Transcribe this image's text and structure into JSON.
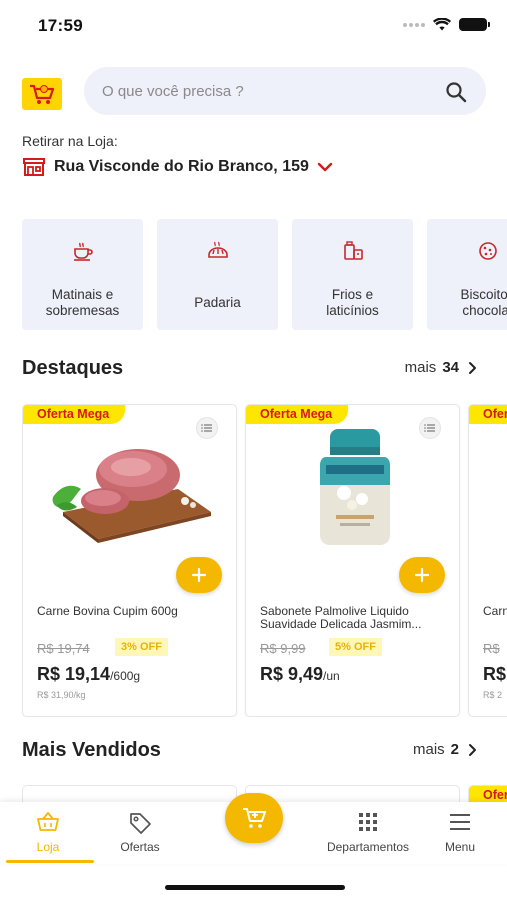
{
  "status_bar": {
    "time": "17:59"
  },
  "search": {
    "placeholder": "O que você precisa ?"
  },
  "pickup": {
    "label": "Retirar na Loja:",
    "store": "Rua Visconde do Rio Branco, 159"
  },
  "categories": [
    {
      "label": "Matinais e\nsobremesas",
      "icon": "coffee-cup-icon"
    },
    {
      "label": "Padaria",
      "icon": "bread-icon"
    },
    {
      "label": "Frios e\nlaticínios",
      "icon": "cheese-icon"
    },
    {
      "label": "Biscoitos\nchocolat",
      "icon": "cookie-icon"
    }
  ],
  "highlights": {
    "title": "Destaques",
    "more_label": "mais",
    "more_count": "34",
    "products": [
      {
        "badge": "Oferta Mega",
        "name": "Carne Bovina Cupim 600g",
        "old_price": "R$ 19,74",
        "discount": "3% OFF",
        "price": "R$ 19,14",
        "price_unit": "/600g",
        "unit_price": "R$ 31,90/kg",
        "image": "beef-image"
      },
      {
        "badge": "Oferta Mega",
        "name": "Sabonete Palmolive Liquido\nSuavidade Delicada Jasmim...",
        "old_price": "R$ 9,99",
        "discount": "5% OFF",
        "price": "R$ 9,49",
        "price_unit": "/un",
        "unit_price": "",
        "image": "soap-bottle-image"
      },
      {
        "badge": "Ofer",
        "name": "Carn",
        "old_price": "R$",
        "discount": "",
        "price": "R$",
        "price_unit": "",
        "unit_price": "R$ 2",
        "image": ""
      }
    ]
  },
  "best_sellers": {
    "title": "Mais Vendidos",
    "more_label": "mais",
    "more_count": "2",
    "peek_badge": "Ofer"
  },
  "bottom_nav": [
    {
      "label": "Loja",
      "icon": "basket-icon",
      "active": true
    },
    {
      "label": "Ofertas",
      "icon": "tag-icon",
      "active": false
    },
    {
      "label": "Departamentos",
      "icon": "grid-icon",
      "active": false
    },
    {
      "label": "Menu",
      "icon": "hamburger-icon",
      "active": false
    }
  ],
  "colors": {
    "accent": "#f5b800",
    "badge_yellow": "#ffe600",
    "badge_text": "#d41a1a",
    "card_bg": "#eef0fa",
    "store_icon": "#d41a1a"
  }
}
